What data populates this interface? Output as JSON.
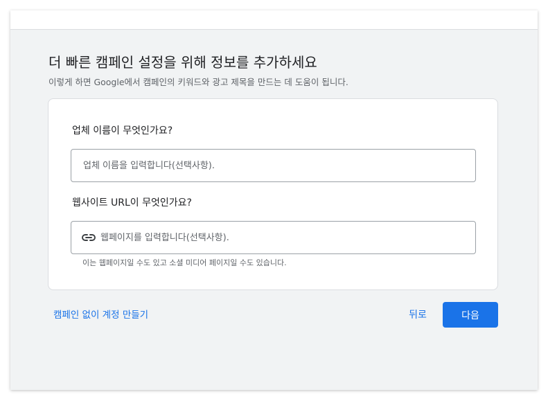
{
  "header": {
    "title": "더 빠른 캠페인 설정을 위해 정보를 추가하세요",
    "subtitle": "이렇게 하면 Google에서 캠페인의 키워드와 광고 제목을 만드는 데 도움이 됩니다."
  },
  "form": {
    "business_name": {
      "label": "업체 이름이 무엇인가요?",
      "value": "",
      "placeholder": "업체 이름을 입력합니다(선택사항)."
    },
    "website": {
      "label": "웹사이트 URL이 무엇인가요?",
      "value": "",
      "placeholder": "웹페이지를 입력합니다(선택사항).",
      "icon": "link-icon",
      "hint": "이는 웹페이지일 수도 있고 소셜 미디어 페이지일 수도 있습니다."
    }
  },
  "footer": {
    "no_campaign_link": "캠페인 없이 계정 만들기",
    "back_label": "뒤로",
    "next_label": "다음"
  },
  "colors": {
    "accent": "#1a73e8",
    "background": "#f1f3f4",
    "text": "#202124",
    "secondary_text": "#5f6368"
  }
}
